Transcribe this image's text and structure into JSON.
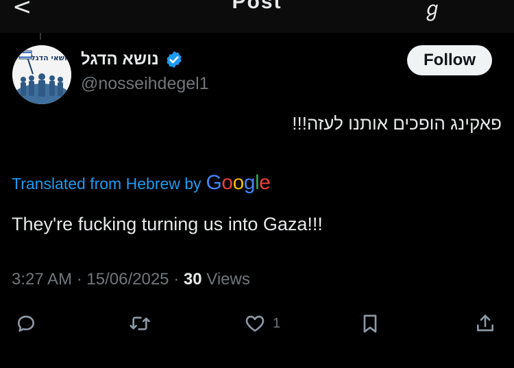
{
  "header": {
    "back_glyph": "<",
    "title": "Post",
    "grok_glyph": "ℊ"
  },
  "post": {
    "author": {
      "display_name": "נושא הדגל",
      "handle": "@nosseihdegel1",
      "verified": true,
      "avatar_text": "נושאי הדגל"
    },
    "follow_label": "Follow",
    "text_original": "פאקינג הופכים אותנו לעזה!!!",
    "translated_prefix": "Translated from Hebrew by",
    "translated_brand": "Google",
    "translation": "They're fucking turning us into Gaza!!!",
    "time": "3:27 AM",
    "date": "15/06/2025",
    "views_count": "30",
    "views_label": "Views",
    "separator": "·",
    "likes_count": "1"
  },
  "colors": {
    "background": "#000000",
    "text": "#e7e9ea",
    "secondary": "#71767b",
    "link": "#1d9bf0",
    "verified": "#1d9bf0",
    "follow_bg": "#eff3f4"
  },
  "icons": [
    "back-arrow-icon",
    "grok-icon",
    "verified-badge-icon",
    "reply-icon",
    "repost-icon",
    "like-icon",
    "bookmark-icon",
    "share-icon"
  ]
}
